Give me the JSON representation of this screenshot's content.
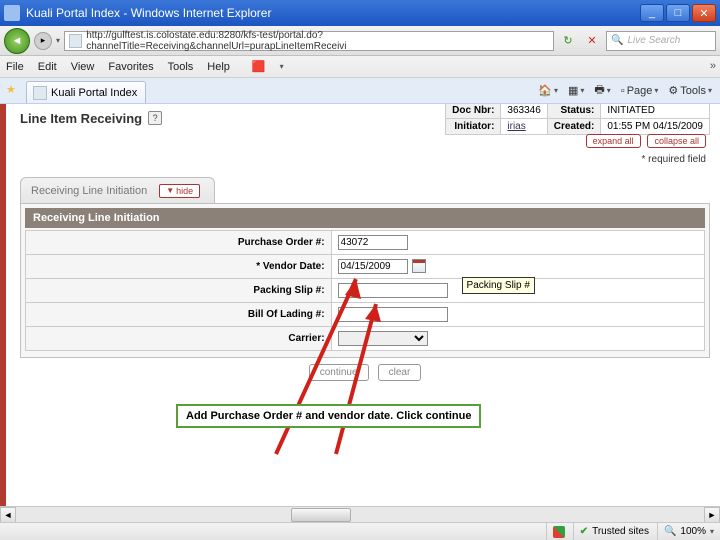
{
  "window": {
    "title": "Kuali Portal Index - Windows Internet Explorer"
  },
  "address": {
    "url": "http://gulftest.is.colostate.edu:8280/kfs-test/portal.do?channelTitle=Receiving&channelUrl=purapLineItemReceivi"
  },
  "search": {
    "placeholder": "Live Search"
  },
  "menu": {
    "file": "File",
    "edit": "Edit",
    "view": "View",
    "favorites": "Favorites",
    "tools": "Tools",
    "help": "Help"
  },
  "tab": {
    "title": "Kuali Portal Index"
  },
  "toolbar": {
    "page": "Page",
    "tools": "Tools"
  },
  "doc": {
    "title": "Line Item Receiving",
    "doc_nbr_label": "Doc Nbr:",
    "doc_nbr": "363346",
    "status_label": "Status:",
    "status": "INITIATED",
    "initiator_label": "Initiator:",
    "initiator": "irias",
    "created_label": "Created:",
    "created": "01:55 PM 04/15/2009"
  },
  "controls": {
    "expand": "expand all",
    "collapse": "collapse all",
    "required": "* required field",
    "hide": "hide"
  },
  "section": {
    "tab_label": "Receiving Line Initiation",
    "heading": "Receiving Line Initiation",
    "po_label": "Purchase Order #:",
    "po_value": "43072",
    "vendor_date_label": "* Vendor Date:",
    "vendor_date_value": "04/15/2009",
    "packing_label": "Packing Slip #:",
    "packing_value": "",
    "bol_label": "Bill Of Lading #:",
    "bol_value": "",
    "carrier_label": "Carrier:",
    "tooltip": "Packing Slip #"
  },
  "actions": {
    "continue": "continue",
    "clear": "clear"
  },
  "annotation": {
    "text": "Add Purchase Order # and vendor date.  Click continue"
  },
  "status": {
    "zone": "Trusted sites",
    "zoom": "100%"
  }
}
